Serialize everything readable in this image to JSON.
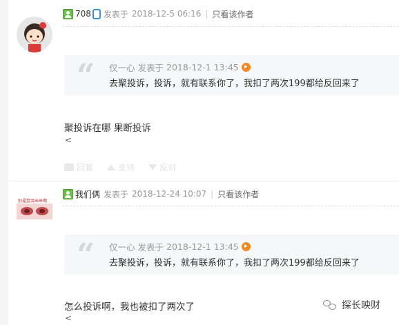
{
  "posts": [
    {
      "username": "708",
      "posted_label": "发表于",
      "posted_time": "2018-12-5 06:16",
      "author_only": "只看该作者",
      "quote": {
        "author": "仅一心",
        "posted_label": "发表于",
        "time": "2018-12-1 13:45",
        "text": "去聚投诉，投诉，就有联系你了，我扣了两次199都给反回来了"
      },
      "body": "聚投诉在哪 果断投诉",
      "suffix": "<",
      "actions": [
        "回复",
        "支持",
        "反对"
      ]
    },
    {
      "username": "我们俩",
      "posted_label": "发表于",
      "posted_time": "2018-12-24 10:07",
      "author_only": "只看该作者",
      "avatar_caption": "别逼我哭出来啊",
      "quote": {
        "author": "仅一心",
        "posted_label": "发表于",
        "time": "2018-12-1 13:45",
        "text": "去聚投诉，投诉，就有联系你了，我扣了两次199都给反回来了"
      },
      "body": "怎么投诉啊，我也被扣了两次了",
      "suffix": "<"
    }
  ],
  "watermark": "探长映财",
  "colors": {
    "meta": "#999999",
    "quote_bg": "#f6f7f9",
    "quote_arrow": "#f08a24",
    "user_icon": "#6cbf4a"
  }
}
